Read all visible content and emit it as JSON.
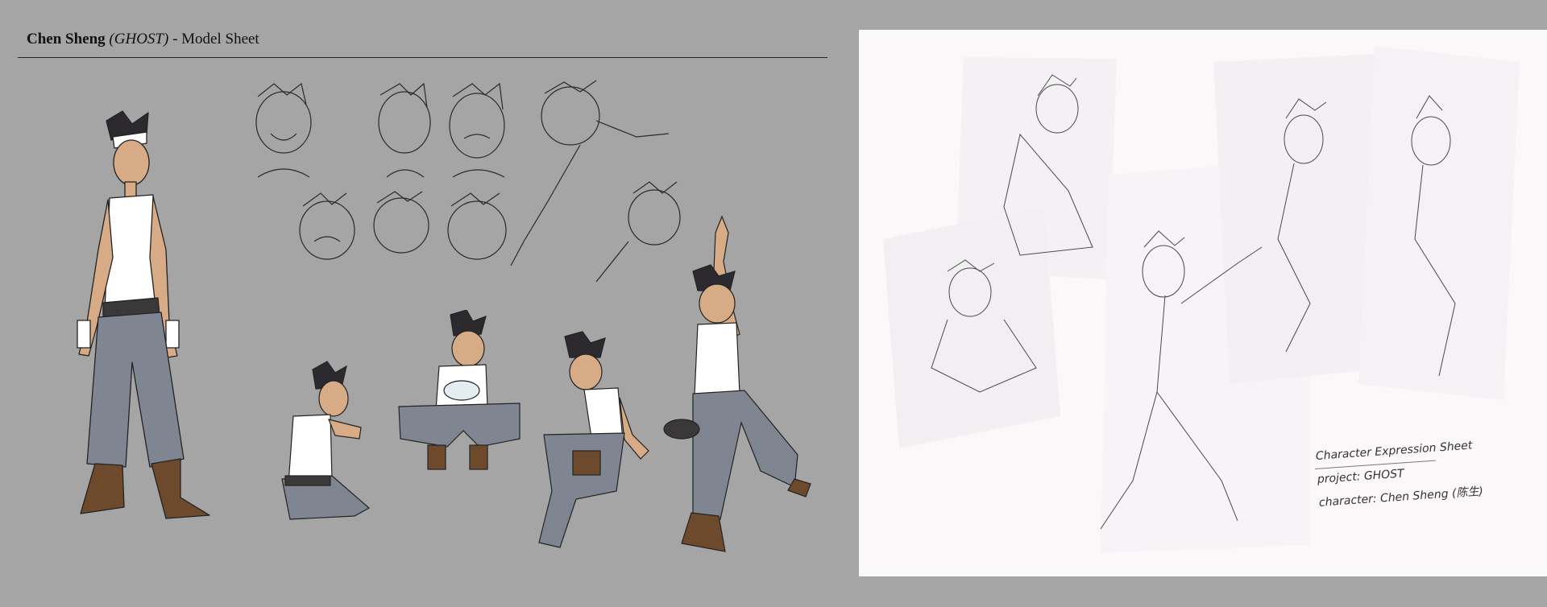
{
  "model_sheet": {
    "title_name": "Chen Sheng",
    "title_alias": "(GHOST)",
    "title_suffix": " - Model Sheet"
  },
  "expression_sheet": {
    "note_line1": "Character Expression Sheet",
    "note_line2": "project: GHOST",
    "note_line3": "character: Chen Sheng (陈生)"
  },
  "colors": {
    "background": "#a5a5a5",
    "paper": "#fbf8fa",
    "skin": "#d6ab85",
    "hair": "#2c2a2e",
    "pants": "#7f8691",
    "boots": "#6e4a2c",
    "tank_top": "#ffffff",
    "belt": "#3a3838"
  }
}
